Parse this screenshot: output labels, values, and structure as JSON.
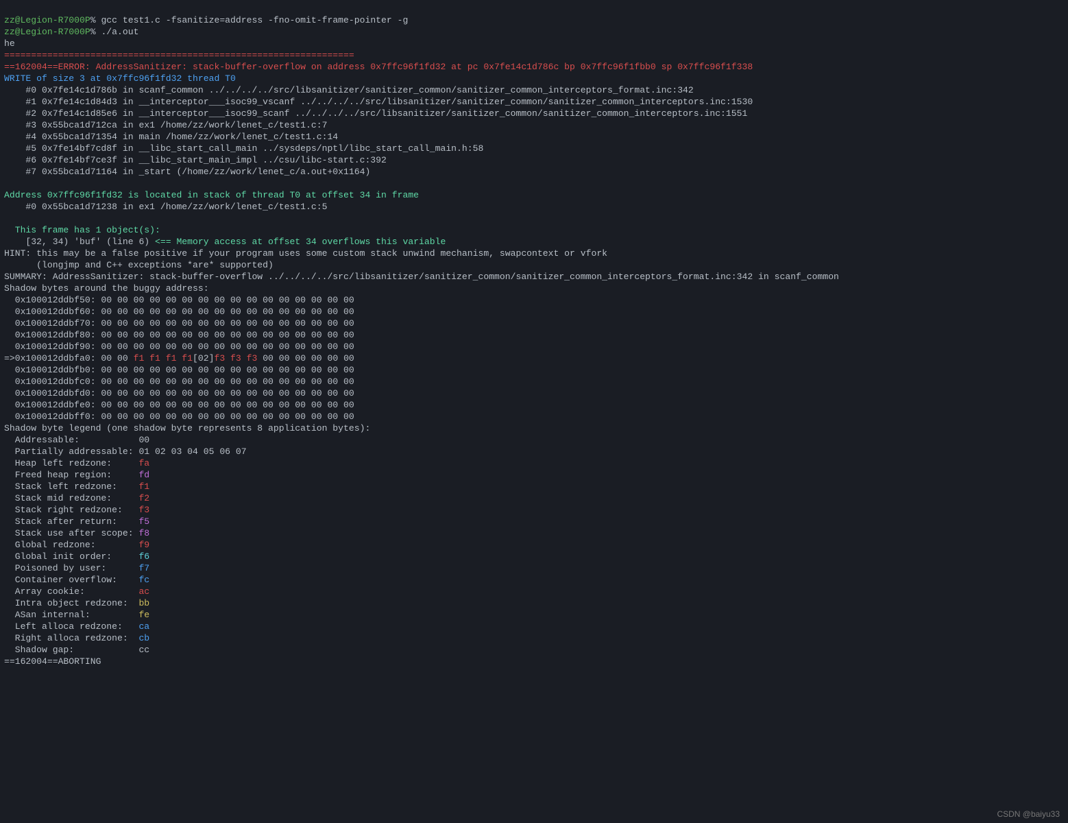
{
  "prompt": {
    "user": "zz",
    "at": "@",
    "host": "Legion-R7000P",
    "sym": "% "
  },
  "cmd1": "gcc test1.c -fsanitize=address -fno-omit-frame-pointer -g",
  "cmd2": "./a.out",
  "out": "he",
  "rule": "=================================================================",
  "err": "==162004==ERROR: AddressSanitizer: stack-buffer-overflow on address 0x7ffc96f1fd32 at pc 0x7fe14c1d786c bp 0x7ffc96f1fbb0 sp 0x7ffc96f1f338",
  "write": "WRITE of size 3 at 0x7ffc96f1fd32 thread T0",
  "bt": [
    "    #0 0x7fe14c1d786b in scanf_common ../../../../src/libsanitizer/sanitizer_common/sanitizer_common_interceptors_format.inc:342",
    "    #1 0x7fe14c1d84d3 in __interceptor___isoc99_vscanf ../../../../src/libsanitizer/sanitizer_common/sanitizer_common_interceptors.inc:1530",
    "    #2 0x7fe14c1d85e6 in __interceptor___isoc99_scanf ../../../../src/libsanitizer/sanitizer_common/sanitizer_common_interceptors.inc:1551",
    "    #3 0x55bca1d712ca in ex1 /home/zz/work/lenet_c/test1.c:7",
    "    #4 0x55bca1d71354 in main /home/zz/work/lenet_c/test1.c:14",
    "    #5 0x7fe14bf7cd8f in __libc_start_call_main ../sysdeps/nptl/libc_start_call_main.h:58",
    "    #6 0x7fe14bf7ce3f in __libc_start_main_impl ../csu/libc-start.c:392",
    "    #7 0x55bca1d71164 in _start (/home/zz/work/lenet_c/a.out+0x1164)"
  ],
  "addr": "Address 0x7ffc96f1fd32 is located in stack of thread T0 at offset 34 in frame",
  "frame": "    #0 0x55bca1d71238 in ex1 /home/zz/work/lenet_c/test1.c:5",
  "objhdr": "  This frame has 1 object(s):",
  "objline_a": "    [32, 34) 'buf' (line 6) ",
  "objline_b": "<== Memory access at offset 34 overflows this variable",
  "hint": [
    "HINT: this may be a false positive if your program uses some custom stack unwind mechanism, swapcontext or vfork",
    "      (longjmp and C++ exceptions *are* supported)"
  ],
  "summary": "SUMMARY: AddressSanitizer: stack-buffer-overflow ../../../../src/libsanitizer/sanitizer_common/sanitizer_common_interceptors_format.inc:342 in scanf_common",
  "shadowhdr": "Shadow bytes around the buggy address:",
  "shadow": [
    "  0x100012ddbf50: 00 00 00 00 00 00 00 00 00 00 00 00 00 00 00 00",
    "  0x100012ddbf60: 00 00 00 00 00 00 00 00 00 00 00 00 00 00 00 00",
    "  0x100012ddbf70: 00 00 00 00 00 00 00 00 00 00 00 00 00 00 00 00",
    "  0x100012ddbf80: 00 00 00 00 00 00 00 00 00 00 00 00 00 00 00 00",
    "  0x100012ddbf90: 00 00 00 00 00 00 00 00 00 00 00 00 00 00 00 00"
  ],
  "shadow_mark": {
    "a": "=>0x100012ddbfa0: 00 00 ",
    "b": "f1 f1 f1 f1",
    "c": "[02]",
    "d": "f3 f3 f3",
    "e": " 00 00 00 00 00 00"
  },
  "shadow2": [
    "  0x100012ddbfb0: 00 00 00 00 00 00 00 00 00 00 00 00 00 00 00 00",
    "  0x100012ddbfc0: 00 00 00 00 00 00 00 00 00 00 00 00 00 00 00 00",
    "  0x100012ddbfd0: 00 00 00 00 00 00 00 00 00 00 00 00 00 00 00 00",
    "  0x100012ddbfe0: 00 00 00 00 00 00 00 00 00 00 00 00 00 00 00 00",
    "  0x100012ddbff0: 00 00 00 00 00 00 00 00 00 00 00 00 00 00 00 00"
  ],
  "legendhdr": "Shadow byte legend (one shadow byte represents 8 application bytes):",
  "legend": [
    {
      "label": "  Addressable:           ",
      "val": "00",
      "cls": ""
    },
    {
      "label": "  Partially addressable: ",
      "val": "01 02 03 04 05 06 07",
      "cls": ""
    },
    {
      "label": "  Heap left redzone:     ",
      "val": "fa",
      "cls": "red"
    },
    {
      "label": "  Freed heap region:     ",
      "val": "fd",
      "cls": "mag"
    },
    {
      "label": "  Stack left redzone:    ",
      "val": "f1",
      "cls": "red"
    },
    {
      "label": "  Stack mid redzone:     ",
      "val": "f2",
      "cls": "red"
    },
    {
      "label": "  Stack right redzone:   ",
      "val": "f3",
      "cls": "red"
    },
    {
      "label": "  Stack after return:    ",
      "val": "f5",
      "cls": "mag"
    },
    {
      "label": "  Stack use after scope: ",
      "val": "f8",
      "cls": "mag"
    },
    {
      "label": "  Global redzone:        ",
      "val": "f9",
      "cls": "red"
    },
    {
      "label": "  Global init order:     ",
      "val": "f6",
      "cls": "cyan"
    },
    {
      "label": "  Poisoned by user:      ",
      "val": "f7",
      "cls": "blue"
    },
    {
      "label": "  Container overflow:    ",
      "val": "fc",
      "cls": "blue"
    },
    {
      "label": "  Array cookie:          ",
      "val": "ac",
      "cls": "red"
    },
    {
      "label": "  Intra object redzone:  ",
      "val": "bb",
      "cls": "yel"
    },
    {
      "label": "  ASan internal:         ",
      "val": "fe",
      "cls": "yel"
    },
    {
      "label": "  Left alloca redzone:   ",
      "val": "ca",
      "cls": "blue"
    },
    {
      "label": "  Right alloca redzone:  ",
      "val": "cb",
      "cls": "blue"
    },
    {
      "label": "  Shadow gap:            ",
      "val": "cc",
      "cls": ""
    }
  ],
  "abort": "==162004==ABORTING",
  "watermark": "CSDN @baiyu33"
}
